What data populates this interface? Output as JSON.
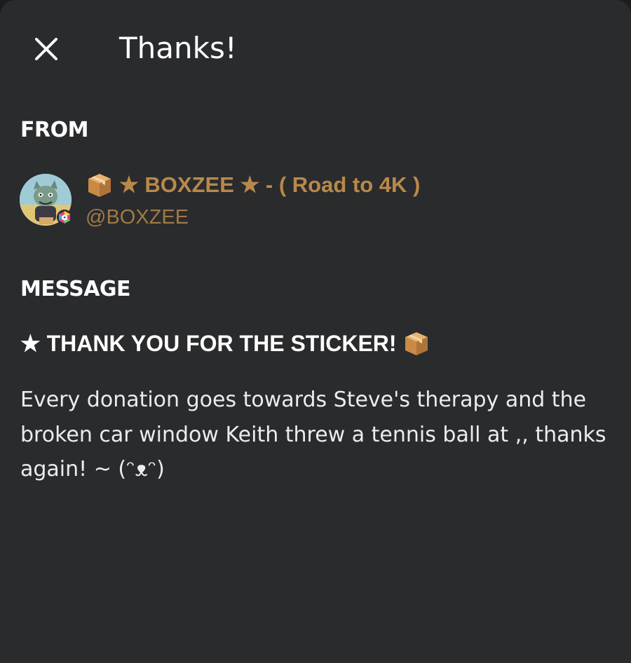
{
  "header": {
    "title": "Thanks!",
    "close_icon": "close-icon"
  },
  "from": {
    "label": "FROM",
    "display_name": "★ BOXZEE ★ - ( Road to 4K )",
    "name_icon": "package-box-icon",
    "handle": "@BOXZEE",
    "name_color": "#b8894a",
    "handle_color": "#a07a45"
  },
  "message": {
    "label": "MESSAGE",
    "heading": "★ THANK YOU FOR THE STICKER!",
    "heading_icon": "package-box-icon",
    "body": "Every donation goes towards Steve's therapy and the broken car window Keith threw a tennis ball at ,, thanks again! ~ (ᵔᴥᵔ)"
  },
  "colors": {
    "background": "#2a2b2d",
    "text": "#ffffff",
    "accent": "#b8894a"
  }
}
